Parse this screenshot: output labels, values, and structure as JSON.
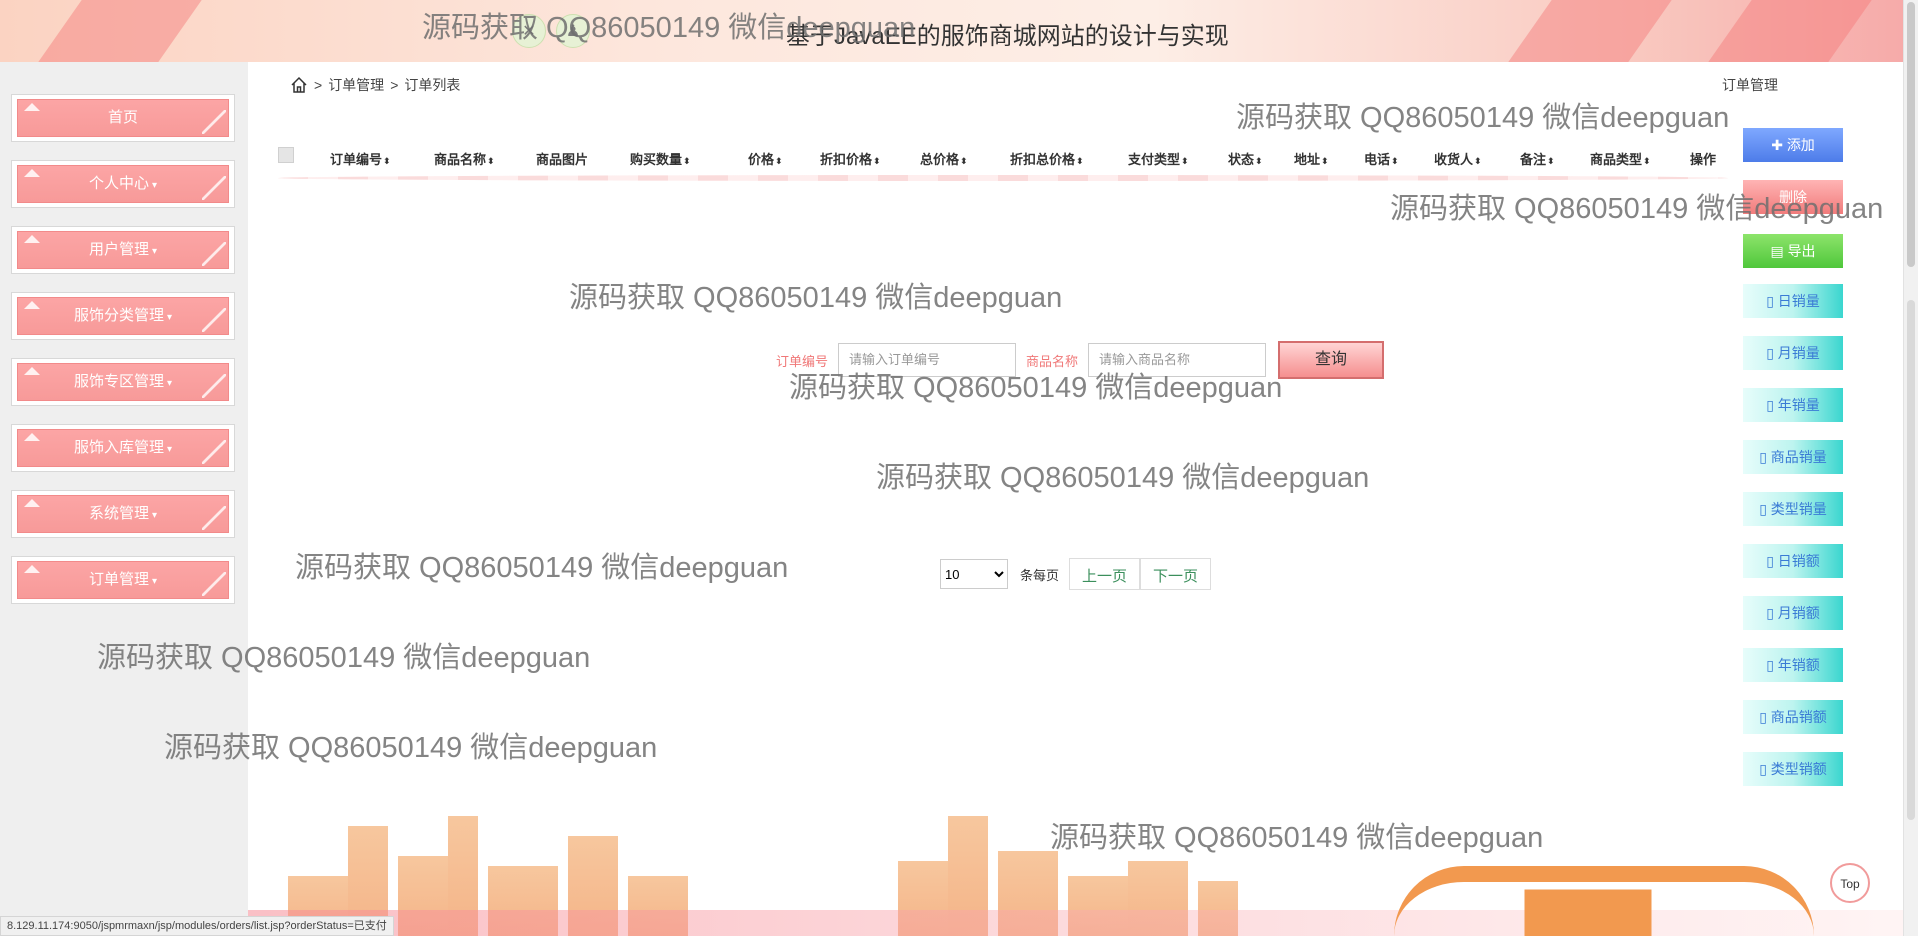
{
  "header": {
    "title": "基于JavaEE的服饰商城网站的设计与实现",
    "icons": [
      "close-icon",
      "user-icon"
    ]
  },
  "sidebar": {
    "items": [
      {
        "label": "首页",
        "has_caret": false
      },
      {
        "label": "个人中心",
        "has_caret": true
      },
      {
        "label": "用户管理",
        "has_caret": true
      },
      {
        "label": "服饰分类管理",
        "has_caret": true
      },
      {
        "label": "服饰专区管理",
        "has_caret": true
      },
      {
        "label": "服饰入库管理",
        "has_caret": true
      },
      {
        "label": "系统管理",
        "has_caret": true
      },
      {
        "label": "订单管理",
        "has_caret": true
      }
    ],
    "caret": "▾"
  },
  "breadcrumb": {
    "items": [
      "订单管理",
      "订单列表"
    ],
    "separator": ">",
    "right": "订单管理"
  },
  "table": {
    "columns": [
      {
        "label": "订单编号",
        "sortable": true
      },
      {
        "label": "商品名称",
        "sortable": true
      },
      {
        "label": "商品图片",
        "sortable": false
      },
      {
        "label": "购买数量",
        "sortable": true
      },
      {
        "label": "价格",
        "sortable": true
      },
      {
        "label": "折扣价格",
        "sortable": true
      },
      {
        "label": "总价格",
        "sortable": true
      },
      {
        "label": "折扣总价格",
        "sortable": true
      },
      {
        "label": "支付类型",
        "sortable": true
      },
      {
        "label": "状态",
        "sortable": true
      },
      {
        "label": "地址",
        "sortable": true
      },
      {
        "label": "电话",
        "sortable": true
      },
      {
        "label": "收货人",
        "sortable": true
      },
      {
        "label": "备注",
        "sortable": true
      },
      {
        "label": "商品类型",
        "sortable": true
      },
      {
        "label": "操作",
        "sortable": false
      }
    ],
    "sort_glyph": "⬍"
  },
  "search": {
    "order_no_label": "订单编号",
    "order_no_placeholder": "请输入订单编号",
    "product_name_label": "商品名称",
    "product_name_placeholder": "请输入商品名称",
    "query_button": "查询"
  },
  "pager": {
    "page_size": "10",
    "per_page_label": "条每页",
    "prev": "上一页",
    "next": "下一页"
  },
  "actions": [
    {
      "label": "添加",
      "icon": "plus-icon",
      "glyph": "✚",
      "style": "blue"
    },
    {
      "label": "删除",
      "icon": "trash-icon",
      "glyph": "",
      "style": "red"
    },
    {
      "label": "导出",
      "icon": "export-icon",
      "glyph": "▤",
      "style": "green"
    },
    {
      "label": "日销量",
      "icon": "document-icon",
      "glyph": "▯",
      "style": "teal"
    },
    {
      "label": "月销量",
      "icon": "document-icon",
      "glyph": "▯",
      "style": "teal"
    },
    {
      "label": "年销量",
      "icon": "document-icon",
      "glyph": "▯",
      "style": "teal"
    },
    {
      "label": "商品销量",
      "icon": "document-icon",
      "glyph": "▯",
      "style": "teal"
    },
    {
      "label": "类型销量",
      "icon": "document-icon",
      "glyph": "▯",
      "style": "teal"
    },
    {
      "label": "日销额",
      "icon": "document-icon",
      "glyph": "▯",
      "style": "teal"
    },
    {
      "label": "月销额",
      "icon": "document-icon",
      "glyph": "▯",
      "style": "teal"
    },
    {
      "label": "年销额",
      "icon": "document-icon",
      "glyph": "▯",
      "style": "teal"
    },
    {
      "label": "商品销额",
      "icon": "document-icon",
      "glyph": "▯",
      "style": "teal"
    },
    {
      "label": "类型销额",
      "icon": "document-icon",
      "glyph": "▯",
      "style": "teal"
    }
  ],
  "watermark_text": "源码获取 QQ86050149 微信deepguan",
  "watermark_header_text": "源码获取 QQ86050149 微信deepguan",
  "top_button": "Top",
  "status_url": "8.129.11.174:9050/jspmrmaxn/jsp/modules/orders/list.jsp?orderStatus=已支付",
  "colors": {
    "sidebar_button": "#fca5a5",
    "label_accent": "#f07878",
    "add_button": "#4d7ce9",
    "export_button": "#4fc73b",
    "stat_button": "#3ad6cf"
  }
}
